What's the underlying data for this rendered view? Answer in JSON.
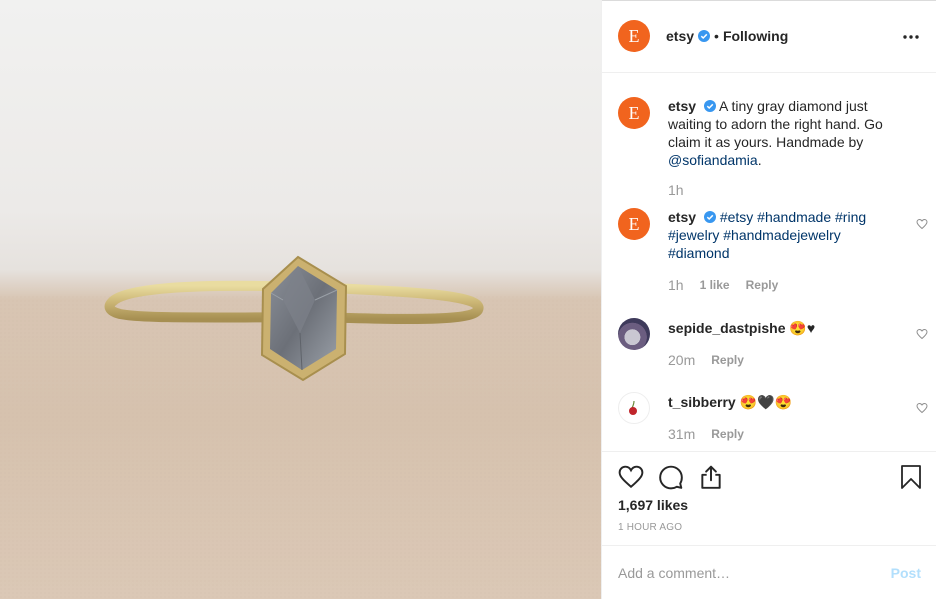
{
  "post": {
    "image_alt": "Gold ring with gray hexagonal diamond",
    "colors": {
      "brand": "#f1641e",
      "link": "#003569",
      "verified": "#3897f0",
      "post_disabled": "#b2dffc"
    }
  },
  "header": {
    "avatar_letter": "E",
    "username": "etsy",
    "separator": "•",
    "follow_status": "Following"
  },
  "caption": {
    "avatar_letter": "E",
    "username": "etsy",
    "text": "A tiny gray diamond just waiting to adorn the right hand. Go claim it as yours. Handmade by ",
    "mention": "@sofiandamia",
    "text_end": ".",
    "time": "1h"
  },
  "comments": [
    {
      "avatar_letter": "E",
      "username": "etsy",
      "hashtags": [
        "#etsy",
        "#handmade",
        "#ring",
        "#jewelry",
        "#handmadejewelry",
        "#diamond"
      ],
      "time": "1h",
      "likes": "1 like",
      "reply": "Reply"
    },
    {
      "username": "sepide_dastpishe",
      "text": "😍♥",
      "time": "20m",
      "reply": "Reply"
    },
    {
      "username": "t_sibberry",
      "text": "😍🖤😍",
      "time": "31m",
      "reply": "Reply"
    }
  ],
  "actions": {
    "icons": [
      "heart-icon",
      "comment-icon",
      "share-icon",
      "bookmark-icon"
    ],
    "likes": "1,697 likes",
    "time_ago": "1 HOUR AGO"
  },
  "add_comment": {
    "placeholder": "Add a comment…",
    "post_label": "Post"
  }
}
